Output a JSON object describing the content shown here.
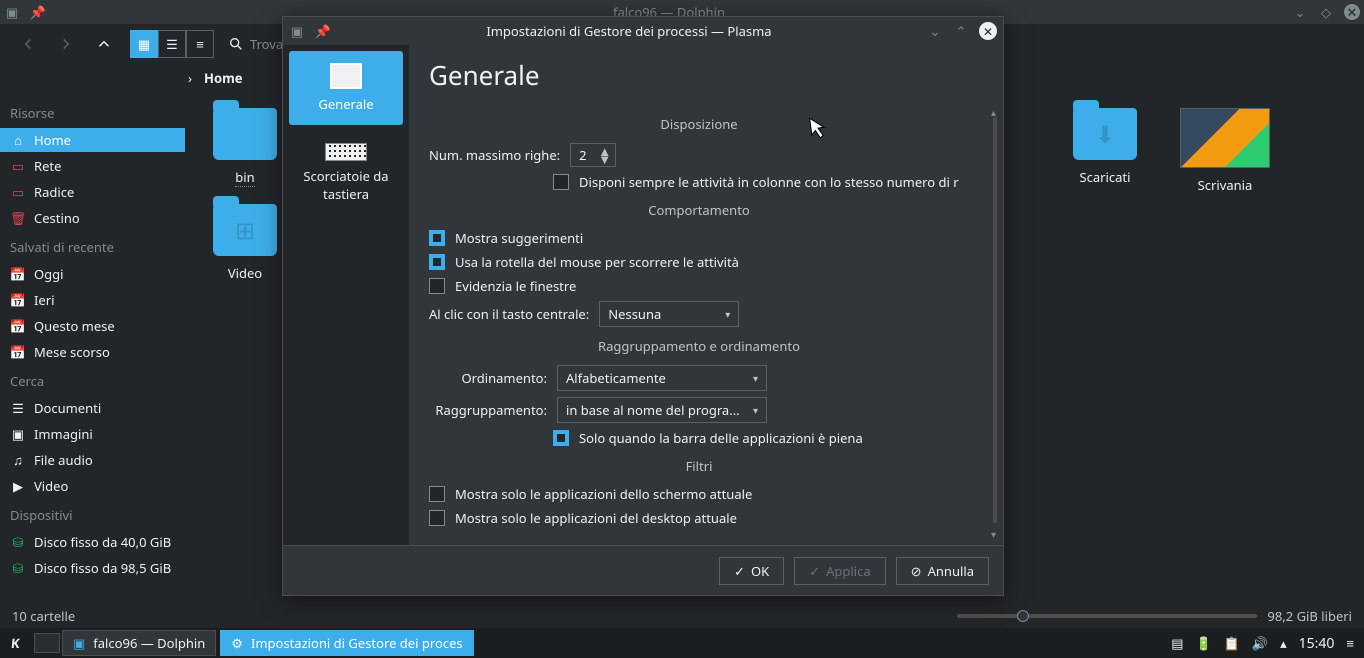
{
  "dolphin": {
    "title": "falco96 — Dolphin",
    "search_placeholder": "Trova",
    "breadcrumb": "Home",
    "files": [
      {
        "name": "bin",
        "type": "folder"
      },
      {
        "name": "Scaricati",
        "type": "folder-download"
      },
      {
        "name": "Scrivania",
        "type": "image"
      },
      {
        "name": "Video",
        "type": "folder-video"
      }
    ],
    "status_left": "10 cartelle",
    "status_right": "98,2 GiB liberi"
  },
  "sidebar": {
    "sections": [
      {
        "title": "Risorse",
        "items": [
          {
            "label": "Home",
            "active": true
          },
          {
            "label": "Rete"
          },
          {
            "label": "Radice"
          },
          {
            "label": "Cestino"
          }
        ]
      },
      {
        "title": "Salvati di recente",
        "items": [
          {
            "label": "Oggi"
          },
          {
            "label": "Ieri"
          },
          {
            "label": "Questo mese"
          },
          {
            "label": "Mese scorso"
          }
        ]
      },
      {
        "title": "Cerca",
        "items": [
          {
            "label": "Documenti"
          },
          {
            "label": "Immagini"
          },
          {
            "label": "File audio"
          },
          {
            "label": "Video"
          }
        ]
      },
      {
        "title": "Dispositivi",
        "items": [
          {
            "label": "Disco fisso da 40,0 GiB"
          },
          {
            "label": "Disco fisso da 98,5 GiB"
          }
        ]
      }
    ]
  },
  "dialog": {
    "title": "Impostazioni di Gestore dei processi — Plasma",
    "nav": {
      "general": "Generale",
      "shortcuts": "Scorciatoie da tastiera"
    },
    "heading": "Generale",
    "section_layout": "Disposizione",
    "max_rows_label": "Num. massimo righe:",
    "max_rows_value": "2",
    "always_columns": "Disponi sempre le attività in colonne con lo stesso numero di r",
    "section_behavior": "Comportamento",
    "show_hints": "Mostra suggerimenti",
    "wheel_scroll": "Usa la rotella del mouse per scorrere le attività",
    "highlight_windows": "Evidenzia le finestre",
    "middle_click_label": "Al clic con il tasto centrale:",
    "middle_click_value": "Nessuna",
    "section_grouping": "Raggruppamento e ordinamento",
    "sort_label": "Ordinamento:",
    "sort_value": "Alfabeticamente",
    "group_label": "Raggruppamento:",
    "group_value": "in base al nome del progra...",
    "only_full": "Solo quando la barra delle applicazioni è piena",
    "section_filters": "Filtri",
    "filter_screen": "Mostra solo le applicazioni dello schermo attuale",
    "filter_desktop": "Mostra solo le applicazioni del desktop attuale",
    "btn_ok": "OK",
    "btn_apply": "Applica",
    "btn_cancel": "Annulla"
  },
  "taskbar": {
    "task1": "falco96 — Dolphin",
    "task2": "Impostazioni di Gestore dei proces",
    "clock": "15:40"
  }
}
